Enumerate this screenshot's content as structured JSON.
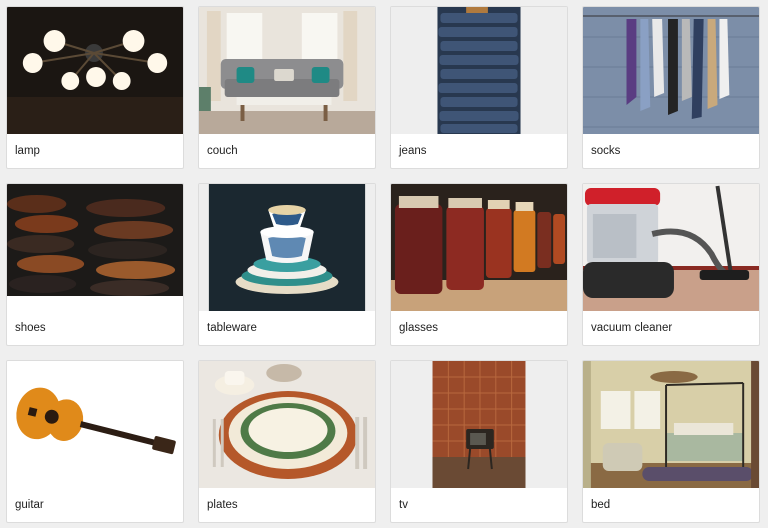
{
  "items": [
    {
      "label": "lamp",
      "image": "chandelier-lamp-photo"
    },
    {
      "label": "couch",
      "image": "living-room-couch-photo"
    },
    {
      "label": "jeans",
      "image": "stacked-jeans-photo"
    },
    {
      "label": "socks",
      "image": "socks-on-line-photo"
    },
    {
      "label": "shoes",
      "image": "rows-of-shoes-photo"
    },
    {
      "label": "tableware",
      "image": "stacked-teacups-photo"
    },
    {
      "label": "glasses",
      "image": "jam-jars-photo"
    },
    {
      "label": "vacuum cleaner",
      "image": "vacuum-cleaner-photo"
    },
    {
      "label": "guitar",
      "image": "acoustic-guitar-photo"
    },
    {
      "label": "plates",
      "image": "place-setting-photo"
    },
    {
      "label": "tv",
      "image": "retro-tv-photo"
    },
    {
      "label": "bed",
      "image": "bedroom-photo"
    }
  ]
}
